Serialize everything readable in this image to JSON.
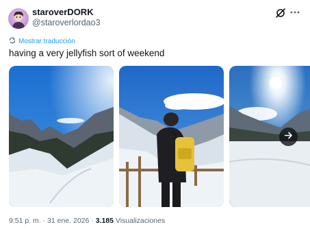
{
  "user": {
    "display_name": "staroverDORK",
    "handle": "@staroverlordao3"
  },
  "tweet": {
    "translate_label": "Mostrar traducción",
    "text": "having a very jellyfish sort of weekend"
  },
  "media": {
    "photos": [
      {
        "subject": "snowy-mountain-trail"
      },
      {
        "subject": "person-with-yellow-backpack-in-snow"
      },
      {
        "subject": "sun-over-snowy-valley"
      }
    ],
    "next_icon": "arrow-right-icon"
  },
  "meta": {
    "time": "9:51 p. m.",
    "sep1": " · ",
    "date": "31 ene. 2026",
    "sep2": " · ",
    "views_count": "3.185",
    "views_label": " Visualizaciones"
  },
  "colors": {
    "accent": "#1d9bf0",
    "secondary_text": "#536471",
    "primary_text": "#0f1419"
  },
  "icons": [
    "grok-icon",
    "more-icon",
    "translate-icon",
    "arrow-right-icon"
  ]
}
